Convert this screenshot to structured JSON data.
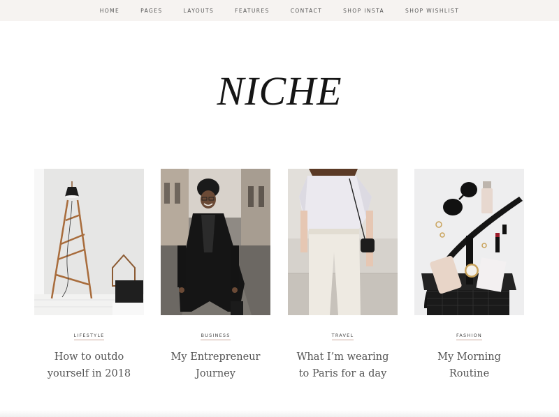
{
  "nav": {
    "items": [
      {
        "label": "HOME"
      },
      {
        "label": "PAGES"
      },
      {
        "label": "LAYOUTS"
      },
      {
        "label": "FEATURES"
      },
      {
        "label": "CONTACT"
      },
      {
        "label": "SHOP INSTA"
      },
      {
        "label": "SHOP WISHLIST"
      }
    ]
  },
  "site": {
    "logo": "NICHE"
  },
  "posts": [
    {
      "category": "LIFESTYLE",
      "title": "How to outdo yourself in 2018",
      "image": "ladder-lamp-photo"
    },
    {
      "category": "BUSINESS",
      "title": "My Entrepreneur Journey",
      "image": "woman-street-photo"
    },
    {
      "category": "TRAVEL",
      "title": "What I’m wearing to Paris for a day",
      "image": "white-outfit-photo"
    },
    {
      "category": "FASHION",
      "title": "My Morning Routine",
      "image": "accessories-flatlay-photo"
    }
  ],
  "colors": {
    "nav_bg": "#f6f3f1",
    "accent_underline": "#c9a79a",
    "text": "#555555"
  }
}
